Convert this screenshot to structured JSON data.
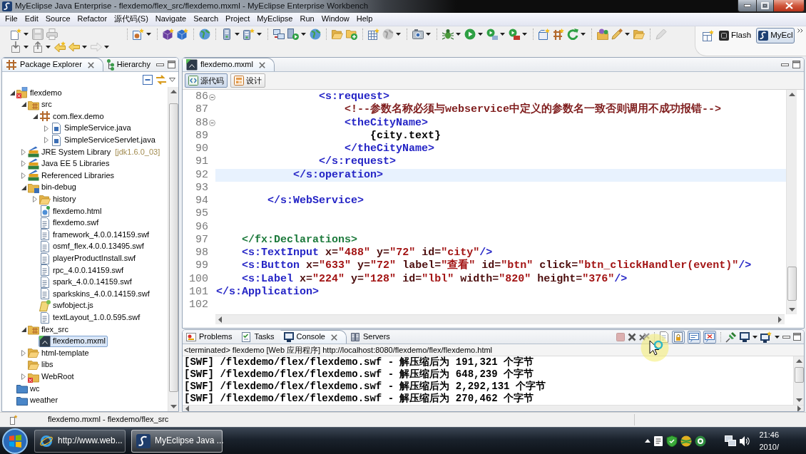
{
  "window": {
    "title": "MyEclipse Java Enterprise - flexdemo/flex_src/flexdemo.mxml - MyEclipse Enterprise Workbench"
  },
  "menu": [
    "File",
    "Edit",
    "Source",
    "Refactor",
    "源代码(S)",
    "Navigate",
    "Search",
    "Project",
    "MyEclipse",
    "Run",
    "Window",
    "Help"
  ],
  "perspectives": [
    {
      "label": "Flash",
      "kind": "flash",
      "selected": false
    },
    {
      "label": "MyEcl",
      "kind": "myeclipse",
      "selected": true
    }
  ],
  "explorer": {
    "tabs": [
      {
        "label": "Package Explorer",
        "kind": "packages",
        "selected": true
      },
      {
        "label": "Hierarchy",
        "kind": "hierarchy",
        "selected": false
      }
    ],
    "tree": [
      {
        "label": "flexdemo",
        "kind": "project",
        "expanded": true,
        "selected": false,
        "children": [
          {
            "label": "src",
            "kind": "source-folder",
            "expanded": true,
            "selected": false,
            "children": [
              {
                "label": "com.flex.demo",
                "kind": "package",
                "expanded": true,
                "selected": false,
                "children": [
                  {
                    "label": "SimpleService.java",
                    "kind": "java",
                    "expanded": false,
                    "selected": false
                  },
                  {
                    "label": "SimpleServiceServlet.java",
                    "kind": "java",
                    "expanded": false,
                    "selected": false
                  }
                ]
              }
            ]
          },
          {
            "label": "JRE System Library",
            "decoration": "[jdk1.6.0_03]",
            "kind": "library",
            "expanded": false,
            "selected": false
          },
          {
            "label": "Java EE 5 Libraries",
            "kind": "library",
            "expanded": false,
            "selected": false
          },
          {
            "label": "Referenced Libraries",
            "kind": "library",
            "expanded": false,
            "selected": false
          },
          {
            "label": "bin-debug",
            "kind": "output-folder",
            "expanded": true,
            "selected": false,
            "children": [
              {
                "label": "history",
                "kind": "folder",
                "expanded": false,
                "selected": false
              },
              {
                "label": "flexdemo.html",
                "kind": "html",
                "selected": false
              },
              {
                "label": "flexdemo.swf",
                "kind": "swf",
                "selected": false
              },
              {
                "label": "framework_4.0.0.14159.swf",
                "kind": "swf",
                "selected": false
              },
              {
                "label": "osmf_flex.4.0.0.13495.swf",
                "kind": "swf",
                "selected": false
              },
              {
                "label": "playerProductInstall.swf",
                "kind": "swf",
                "selected": false
              },
              {
                "label": "rpc_4.0.0.14159.swf",
                "kind": "swf",
                "selected": false
              },
              {
                "label": "spark_4.0.0.14159.swf",
                "kind": "swf",
                "selected": false
              },
              {
                "label": "sparkskins_4.0.0.14159.swf",
                "kind": "swf",
                "selected": false
              },
              {
                "label": "swfobject.js",
                "kind": "js",
                "selected": false
              },
              {
                "label": "textLayout_1.0.0.595.swf",
                "kind": "swf",
                "selected": false
              }
            ]
          },
          {
            "label": "flex_src",
            "kind": "source-folder",
            "expanded": true,
            "selected": false,
            "children": [
              {
                "label": "flexdemo.mxml",
                "kind": "mxml",
                "selected": true
              }
            ]
          },
          {
            "label": "html-template",
            "kind": "folder",
            "expanded": false,
            "selected": false
          },
          {
            "label": "libs",
            "kind": "folder",
            "selected": false
          },
          {
            "label": "WebRoot",
            "kind": "web-folder",
            "expanded": false,
            "selected": false
          }
        ]
      },
      {
        "label": "wc",
        "kind": "closed-project",
        "selected": false
      },
      {
        "label": "weather",
        "kind": "closed-project",
        "selected": false
      }
    ]
  },
  "editor": {
    "tabs": [
      {
        "label": "flexdemo.mxml",
        "selected": true
      }
    ],
    "modes": [
      {
        "label": "源代码",
        "kind": "source",
        "selected": true
      },
      {
        "label": "设计",
        "kind": "design",
        "selected": false
      }
    ],
    "lines": [
      {
        "number": "86",
        "fold": true,
        "current": false,
        "tokens": [
          {
            "text": "                <s:request>",
            "kind": "tag"
          }
        ]
      },
      {
        "number": "87",
        "fold": false,
        "current": false,
        "tokens": [
          {
            "text": "                    <!--参数名称必须与webservice中定义的参数名一致否则调用不成功报错-->",
            "kind": "comment"
          }
        ]
      },
      {
        "number": "88",
        "fold": true,
        "current": false,
        "tokens": [
          {
            "text": "                    <theCityName>",
            "kind": "tag"
          }
        ]
      },
      {
        "number": "89",
        "fold": false,
        "current": false,
        "tokens": [
          {
            "text": "                        {city.text}",
            "kind": "text"
          }
        ]
      },
      {
        "number": "90",
        "fold": false,
        "current": false,
        "tokens": [
          {
            "text": "                    </theCityName>",
            "kind": "tag"
          }
        ]
      },
      {
        "number": "91",
        "fold": false,
        "current": false,
        "tokens": [
          {
            "text": "                </s:request>",
            "kind": "tag"
          }
        ]
      },
      {
        "number": "92",
        "fold": false,
        "current": true,
        "tokens": [
          {
            "text": "            </s:operation>",
            "kind": "tag"
          }
        ]
      },
      {
        "number": "93",
        "fold": false,
        "current": false
      },
      {
        "number": "94",
        "fold": false,
        "current": false,
        "tokens": [
          {
            "text": "        </s:WebService>",
            "kind": "tag"
          }
        ]
      },
      {
        "number": "95",
        "fold": false,
        "current": false
      },
      {
        "number": "96",
        "fold": false,
        "current": false
      },
      {
        "number": "97",
        "fold": false,
        "current": false,
        "tokens": [
          {
            "text": "    </fx:Declarations>",
            "kind": "fx-tag"
          }
        ]
      },
      {
        "number": "98",
        "fold": false,
        "current": false,
        "tokens": [
          {
            "text": "    <s:TextInput",
            "kind": "tag"
          },
          {
            "text": " x=",
            "kind": "attribute"
          },
          {
            "text": "\"488\"",
            "kind": "value"
          },
          {
            "text": " y=",
            "kind": "attribute"
          },
          {
            "text": "\"72\"",
            "kind": "value"
          },
          {
            "text": " id=",
            "kind": "attribute"
          },
          {
            "text": "\"city\"",
            "kind": "value"
          },
          {
            "text": "/>",
            "kind": "tag"
          }
        ]
      },
      {
        "number": "99",
        "fold": false,
        "current": false,
        "tokens": [
          {
            "text": "    <s:Button",
            "kind": "tag"
          },
          {
            "text": " x=",
            "kind": "attribute"
          },
          {
            "text": "\"633\"",
            "kind": "value"
          },
          {
            "text": " y=",
            "kind": "attribute"
          },
          {
            "text": "\"72\"",
            "kind": "value"
          },
          {
            "text": " label=",
            "kind": "attribute"
          },
          {
            "text": "\"查看\"",
            "kind": "value"
          },
          {
            "text": " id=",
            "kind": "attribute"
          },
          {
            "text": "\"btn\"",
            "kind": "value"
          },
          {
            "text": " click=",
            "kind": "attribute"
          },
          {
            "text": "\"btn_clickHandler(event)\"",
            "kind": "value"
          },
          {
            "text": "/>",
            "kind": "tag"
          }
        ]
      },
      {
        "number": "100",
        "fold": false,
        "current": false,
        "tokens": [
          {
            "text": "    <s:Label",
            "kind": "tag"
          },
          {
            "text": " x=",
            "kind": "attribute"
          },
          {
            "text": "\"224\"",
            "kind": "value"
          },
          {
            "text": " y=",
            "kind": "attribute"
          },
          {
            "text": "\"128\"",
            "kind": "value"
          },
          {
            "text": " id=",
            "kind": "attribute"
          },
          {
            "text": "\"lbl\"",
            "kind": "value"
          },
          {
            "text": " width=",
            "kind": "attribute"
          },
          {
            "text": "\"820\"",
            "kind": "value"
          },
          {
            "text": " height=",
            "kind": "attribute"
          },
          {
            "text": "\"376\"",
            "kind": "value"
          },
          {
            "text": "/>",
            "kind": "tag"
          }
        ]
      },
      {
        "number": "101",
        "fold": false,
        "current": false,
        "tokens": [
          {
            "text": "</s:Application>",
            "kind": "tag"
          }
        ]
      },
      {
        "number": "102",
        "fold": false,
        "current": false
      }
    ]
  },
  "console": {
    "tabs": [
      {
        "label": "Problems",
        "kind": "problems",
        "selected": false
      },
      {
        "label": "Tasks",
        "kind": "tasks",
        "selected": false
      },
      {
        "label": "Console",
        "kind": "console",
        "selected": true
      },
      {
        "label": "Servers",
        "kind": "servers",
        "selected": false
      }
    ],
    "header": "<terminated> flexdemo [Web 应用程序] http://localhost:8080/flexdemo/flex/flexdemo.html",
    "lines": [
      "[SWF] /flexdemo/flex/flexdemo.swf - 解压缩后为 191,321 个字节",
      "[SWF] /flexdemo/flex/flexdemo.swf - 解压缩后为 648,239 个字节",
      "[SWF] /flexdemo/flex/flexdemo.swf - 解压缩后为 2,292,131 个字节",
      "[SWF] /flexdemo/flex/flexdemo.swf - 解压缩后为 270,462 个字节"
    ]
  },
  "status_bar": {
    "text": "flexdemo.mxml - flexdemo/flex_src"
  },
  "taskbar": {
    "buttons": [
      {
        "label": "http://www.web...",
        "kind": "browser",
        "selected": false
      },
      {
        "label": "MyEclipse Java ...",
        "kind": "ide",
        "selected": true
      }
    ],
    "time": "21:46",
    "date": "2010/"
  }
}
